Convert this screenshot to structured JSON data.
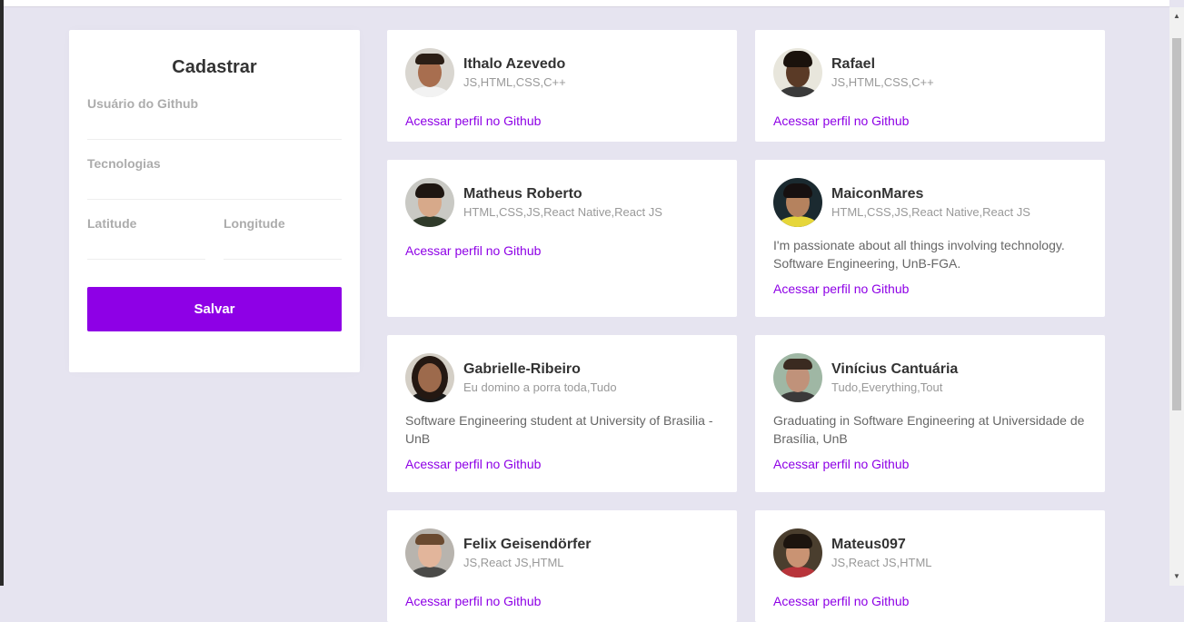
{
  "form": {
    "title": "Cadastrar",
    "github_username_label": "Usuário do Github",
    "github_username_value": "",
    "techs_label": "Tecnologias",
    "techs_value": "",
    "latitude_label": "Latitude",
    "latitude_value": "",
    "longitude_label": "Longitude",
    "longitude_value": "",
    "save_label": "Salvar"
  },
  "link_label": "Acessar perfil no Github",
  "devs": [
    {
      "name": "Ithalo Azevedo",
      "techs": "JS,HTML,CSS,C++",
      "bio": "",
      "link": "Acessar perfil no Github"
    },
    {
      "name": "Rafael",
      "techs": "JS,HTML,CSS,C++",
      "bio": "",
      "link": "Acessar perfil no Github"
    },
    {
      "name": "Matheus Roberto",
      "techs": "HTML,CSS,JS,React Native,React JS",
      "bio": "",
      "link": "Acessar perfil no Github"
    },
    {
      "name": "MaiconMares",
      "techs": "HTML,CSS,JS,React Native,React JS",
      "bio": "I'm passionate about all things involving technology. Software Engineering, UnB-FGA.",
      "link": "Acessar perfil no Github"
    },
    {
      "name": "Gabrielle-Ribeiro",
      "techs": "Eu domino a porra toda,Tudo",
      "bio": "Software Engineering student at University of Brasilia - UnB",
      "link": "Acessar perfil no Github"
    },
    {
      "name": "Vinícius Cantuária",
      "techs": "Tudo,Everything,Tout",
      "bio": "Graduating in Software Engineering at Universidade de Brasília, UnB",
      "link": "Acessar perfil no Github"
    },
    {
      "name": "Felix Geisendörfer",
      "techs": "JS,React JS,HTML",
      "bio": "",
      "link": "Acessar perfil no Github"
    },
    {
      "name": "Mateus097",
      "techs": "JS,React JS,HTML",
      "bio": "",
      "link": "Acessar perfil no Github"
    }
  ],
  "colors": {
    "accent": "#8e00e6",
    "background": "#e6e4f0"
  }
}
